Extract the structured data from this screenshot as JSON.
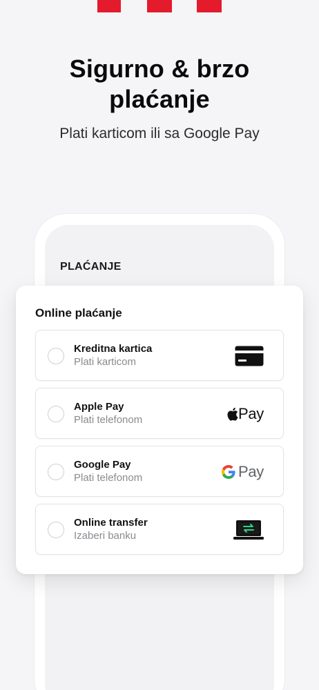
{
  "header": {
    "title_line1": "Sigurno & brzo",
    "title_line2": "plaćanje",
    "subtitle": "Plati karticom ili sa Google Pay"
  },
  "phone": {
    "screen_title": "PLAĆANJE"
  },
  "payment_card": {
    "title": "Online plaćanje",
    "options": [
      {
        "title": "Kreditna kartica",
        "subtitle": "Plati karticom",
        "icon": "credit-card-icon"
      },
      {
        "title": "Apple Pay",
        "subtitle": "Plati telefonom",
        "icon": "apple-pay-icon",
        "icon_text": "Pay"
      },
      {
        "title": "Google Pay",
        "subtitle": "Plati telefonom",
        "icon": "google-pay-icon",
        "icon_text": "Pay"
      },
      {
        "title": "Online transfer",
        "subtitle": "Izaberi banku",
        "icon": "laptop-transfer-icon"
      }
    ]
  },
  "colors": {
    "brand_red": "#e31b2c",
    "background": "#f5f5f7",
    "google_blue": "#4285F4",
    "google_red": "#EA4335",
    "google_yellow": "#FBBC05",
    "google_green": "#34A853",
    "transfer_green": "#2bd48a"
  }
}
